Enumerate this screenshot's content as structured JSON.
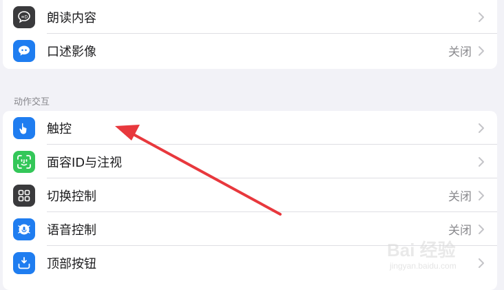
{
  "group1": {
    "rows": [
      {
        "label": "朗读内容",
        "value": "",
        "icon": "speech-bubble-icon",
        "icon_bg": "#3a3a3c"
      },
      {
        "label": "口述影像",
        "value": "关闭",
        "icon": "chat-bubble-icon",
        "icon_bg": "#1f7df0"
      }
    ]
  },
  "section_header": "动作交互",
  "group2": {
    "rows": [
      {
        "label": "触控",
        "value": "",
        "icon": "hand-touch-icon",
        "icon_bg": "#1f7df0"
      },
      {
        "label": "面容ID与注视",
        "value": "",
        "icon": "face-id-icon",
        "icon_bg": "#34c759"
      },
      {
        "label": "切换控制",
        "value": "关闭",
        "icon": "grid-squares-icon",
        "icon_bg": "#3a3a3c"
      },
      {
        "label": "语音控制",
        "value": "关闭",
        "icon": "voice-control-icon",
        "icon_bg": "#1f7df0"
      },
      {
        "label": "顶部按钮",
        "value": "",
        "icon": "top-button-icon",
        "icon_bg": "#1f7df0"
      }
    ]
  },
  "annotation": {
    "color": "#e8383d"
  },
  "watermark": {
    "logo": "Bai 经验",
    "url": "jingyan.baidu.com"
  }
}
